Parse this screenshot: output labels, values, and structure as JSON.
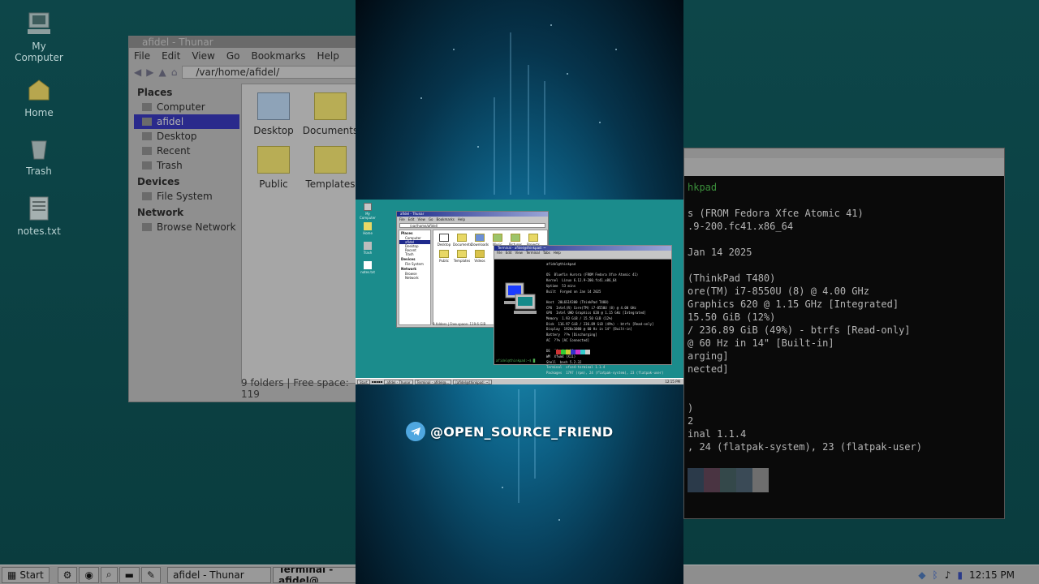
{
  "desktop_icons": [
    {
      "label": "My\nComputer"
    },
    {
      "label": "Home"
    },
    {
      "label": "Trash"
    },
    {
      "label": "notes.txt"
    }
  ],
  "thunar": {
    "title": "afidel - Thunar",
    "menu": [
      "File",
      "Edit",
      "View",
      "Go",
      "Bookmarks",
      "Help"
    ],
    "location": "/var/home/afidel/",
    "sidebar": {
      "places_heading": "Places",
      "places": [
        "Computer",
        "afidel",
        "Desktop",
        "Recent",
        "Trash"
      ],
      "devices_heading": "Devices",
      "devices": [
        "File System"
      ],
      "network_heading": "Network",
      "network": [
        "Browse Network"
      ]
    },
    "files": [
      "Desktop",
      "Documents",
      "Public",
      "Templates"
    ],
    "status": "9 folders  |  Free space: 119"
  },
  "terminal_bg": {
    "lines": [
      "hkpad",
      "",
      "s (FROM Fedora Xfce Atomic 41)",
      ".9-200.fc41.x86_64",
      "",
      "Jan 14 2025",
      "",
      "(ThinkPad T480)",
      "ore(TM) i7-8550U (8) @ 4.00 GHz",
      "Graphics 620 @ 1.15 GHz [Integrated]",
      " 15.50 GiB (12%)",
      " / 236.89 GiB (49%) - btrfs [Read-only]",
      "@ 60 Hz in 14\" [Built-in]",
      "arging]",
      "nected]",
      "",
      "",
      ")",
      "2",
      "inal 1.1.4",
      ", 24 (flatpak-system), 23 (flatpak-user)"
    ]
  },
  "taskbar": {
    "start": "Start",
    "tasks": [
      "afidel - Thunar",
      "Terminal - afidel@"
    ],
    "clock": "12:15 PM"
  },
  "mini": {
    "desktop_icons": [
      "My Computer",
      "Home",
      "Trash",
      "notes.txt"
    ],
    "thunar_title": "afidel - Thunar",
    "thunar_menu": [
      "File",
      "Edit",
      "View",
      "Go",
      "Bookmarks",
      "Help"
    ],
    "location": "/var/home/afidel/",
    "sidebar": [
      "Places",
      "Computer",
      "afidel",
      "Desktop",
      "Recent",
      "Trash",
      "Devices",
      "File System",
      "Network",
      "Browse Network"
    ],
    "files": [
      "Desktop",
      "Documents",
      "Downloads",
      "Music",
      "Pictures",
      "Projects",
      "Public",
      "Templates",
      "Videos"
    ],
    "status": "9 folders | Free space: 119.6 GiB",
    "terminal_title": "Terminal - afidel@thinkpad: ~",
    "terminal_menu": [
      "File",
      "Edit",
      "View",
      "Terminal",
      "Tabs",
      "Help"
    ],
    "terminal_lines": "afidel@thinkpad\n\nOS  Bluefin Aurora (FROM Fedora Xfce Atomic 41)\nKernel  Linux 6.12.9-200.fc41.x86_64\nUptime  53 mins\nBuilt  Forged on Jan 14 2025\n\nHost  20L6S1V300 (ThinkPad T480)\nCPU  Intel(R) Core(TM) i7-8550U (8) @ 4.00 GHz\nGPU  Intel UHD Graphics 620 @ 1.15 GHz [Integrated]\nMemory  1.93 GiB / 15.50 GiB (12%)\nDisk  116.97 GiB / 236.89 GiB (49%) - btrfs [Read-only]\nDisplay  1920x1080 @ 60 Hz in 14\" [Built-in]\nBattery  ??% [Discharging]\nAC  ??% [AC Connected]\n\nDE  Xfce4 4.18\nWM  Xfwm4 (X11)\nShell  bash 5.2.32\nTerminal  xfce4-terminal 1.1.4\nPackages  1797 (rpm), 24 (flatpak-system), 23 (flatpak-user)",
    "prompt": "afidel@thinkpad:~$",
    "taskbar_start": "Start",
    "taskbar_tasks": [
      "afidel - Thunar",
      "Terminal - afidel@...",
      "[afidel@thinkpad: ~]"
    ],
    "clock": "12:15 PM"
  },
  "handle": "@OPEN_SOURCE_FRIEND",
  "colors": {
    "desktop_teal": "#1b8c8c",
    "selection_blue": "#1f2a8c",
    "telegram_blue": "#4fa7e0"
  }
}
